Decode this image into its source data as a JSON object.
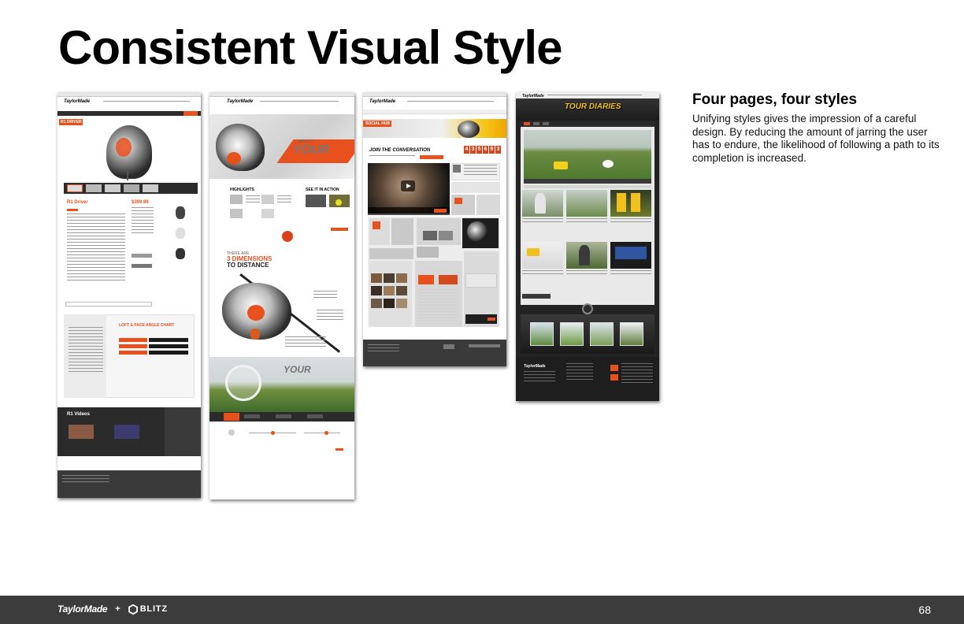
{
  "slide": {
    "title": "Consistent Visual Style",
    "page_number": "68"
  },
  "sidebar": {
    "heading": "Four pages, four styles",
    "body": "Unifying styles gives the impression of a careful design. By reducing the amount of jarring the user has to endure, the likelihood of following a path to its completion is increased."
  },
  "footer": {
    "brand_taylormade": "TaylorMade",
    "plus": "+",
    "brand_blitz": "BLITZ"
  },
  "thumb1": {
    "logo": "TaylorMade",
    "tag": "R1 DRIVER",
    "product_name": "R1 Driver",
    "price": "$399.99",
    "loft_chart_title": "LOFT & FACE ANGLE CHART",
    "videos_heading": "R1 Videos"
  },
  "thumb2": {
    "logo": "TaylorMade",
    "make_it": "MAKE IT",
    "yours": "YOUR",
    "highlights": "HIGHLIGHTS",
    "see_it": "SEE IT IN ACTION",
    "there_are": "THERE ARE",
    "three_dimensions": "3 DIMENSIONS",
    "to_distance": "TO DISTANCE"
  },
  "thumb3": {
    "logo": "TaylorMade",
    "tag": "SOCIAL HUB",
    "join": "JOIN THE CONVERSATION",
    "counter": [
      "4",
      "3",
      "5",
      "6",
      "9",
      "3"
    ]
  },
  "thumb4": {
    "logo": "TaylorMade",
    "banner": "TOUR DIARIES"
  },
  "colors": {
    "accent_orange": "#e8501e",
    "footer_bg": "#3c3c3c",
    "dark_panel": "#2b2b2b",
    "tour_yellow": "#f2c01d"
  }
}
